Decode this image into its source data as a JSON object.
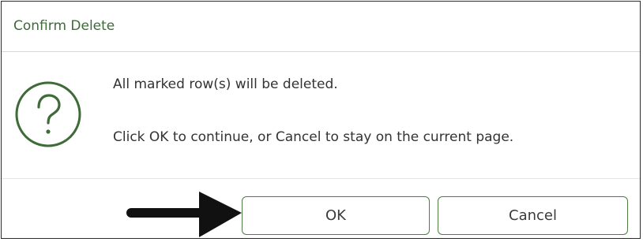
{
  "dialog": {
    "title": "Confirm Delete",
    "icon": "question-circle-icon",
    "message_line1": "All marked row(s) will be deleted.",
    "message_line2": "Click OK to continue, or Cancel to stay on the current page.",
    "ok_label": "OK",
    "cancel_label": "Cancel"
  },
  "annotation": {
    "icon": "pointer-arrow-icon",
    "color": "#111111"
  },
  "colors": {
    "title": "#3e6b38",
    "button_border": "#4f7d45",
    "icon": "#3e6b38"
  }
}
